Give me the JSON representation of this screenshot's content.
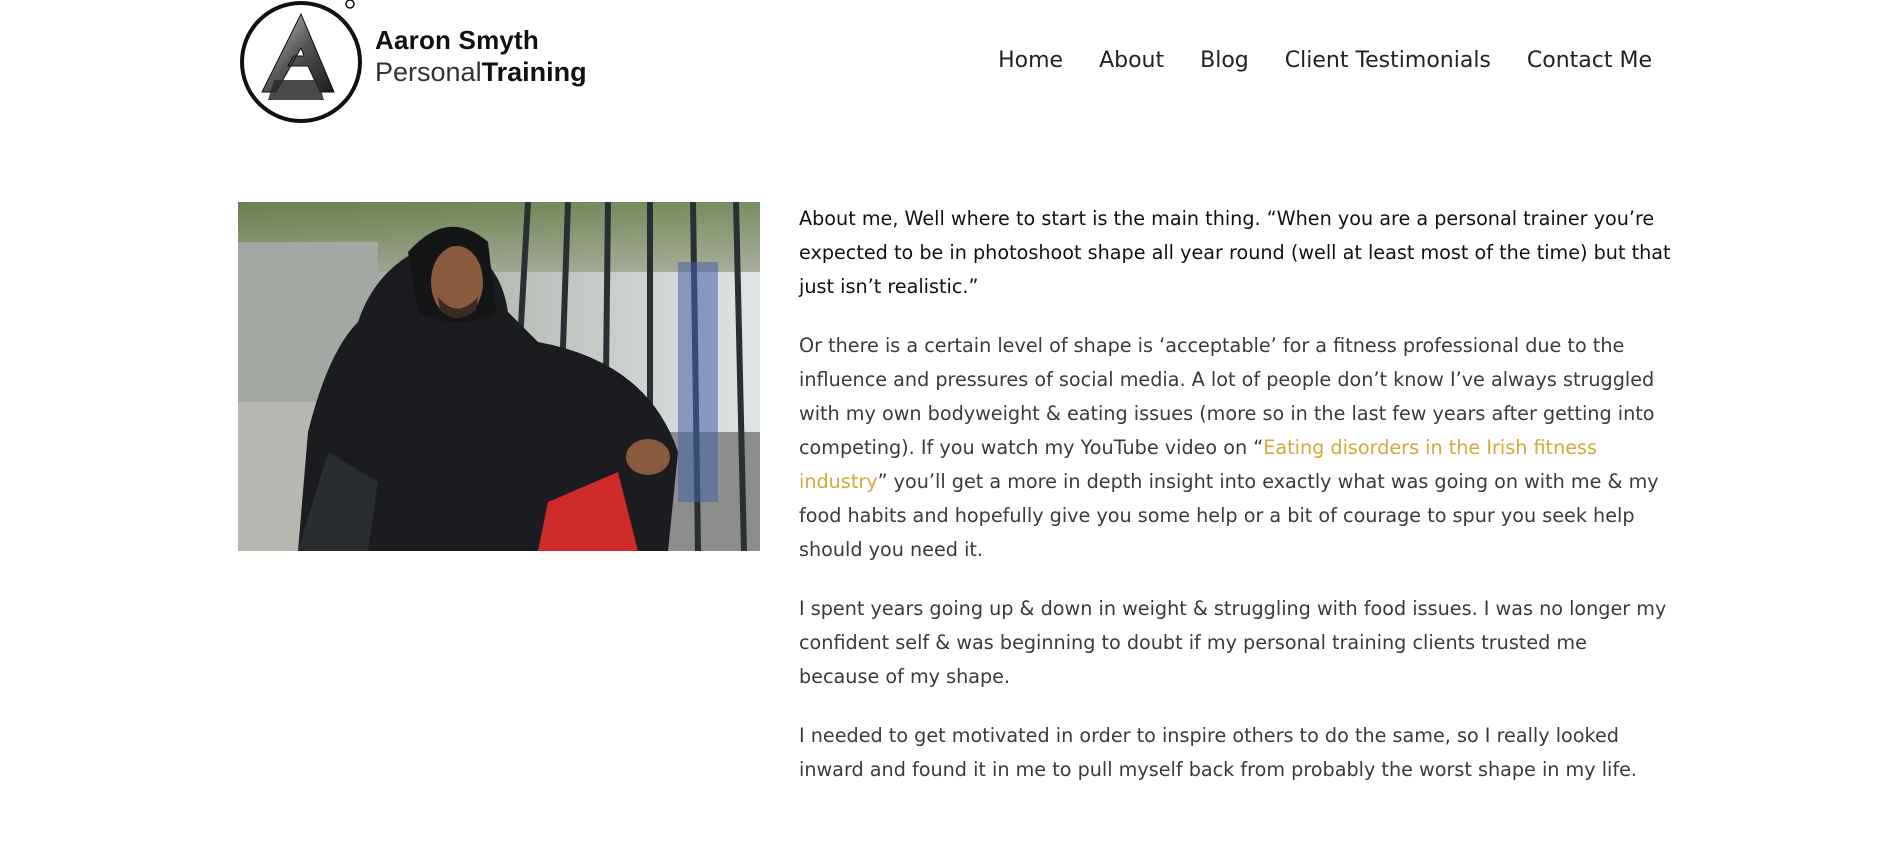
{
  "brand": {
    "name": "Aaron Smyth",
    "subtitle_light": "Personal",
    "subtitle_bold": "Training",
    "registered_mark": "®"
  },
  "nav": {
    "items": [
      {
        "label": "Home"
      },
      {
        "label": "About"
      },
      {
        "label": "Blog"
      },
      {
        "label": "Client Testimonials"
      },
      {
        "label": "Contact Me"
      }
    ]
  },
  "about": {
    "lead": "About me, Well where to start is the main thing. “When you are a personal trainer you’re expected to be in photoshoot shape all year round (well at least most of the time) but that just isn’t realistic.”",
    "p2_before": "Or there is a certain level of shape is ‘acceptable’ for a fitness professional due to the influence and pressures of social media. A lot of people don’t know I’ve always struggled with my own bodyweight & eating issues (more so in the last few years after getting into competing). If you watch my YouTube video on “",
    "p2_link": "Eating disorders in the Irish fitness industry",
    "p2_after": "” you’ll get a more in depth insight into exactly what was going on with me & my food habits and hopefully give you some help or a bit of courage to spur you seek help should you need it.",
    "p3": "I spent years going up & down in weight & struggling with food issues. I was no longer my confident self & was beginning to doubt if my personal training clients trusted me because of my shape.",
    "p4": "I needed to get motivated in order to inspire others to do the same, so I really looked inward and found it in me to pull myself back from probably the worst shape in my life."
  },
  "colors": {
    "link": "#d4a93a",
    "text": "#3a3a3a",
    "heading": "#111111"
  }
}
